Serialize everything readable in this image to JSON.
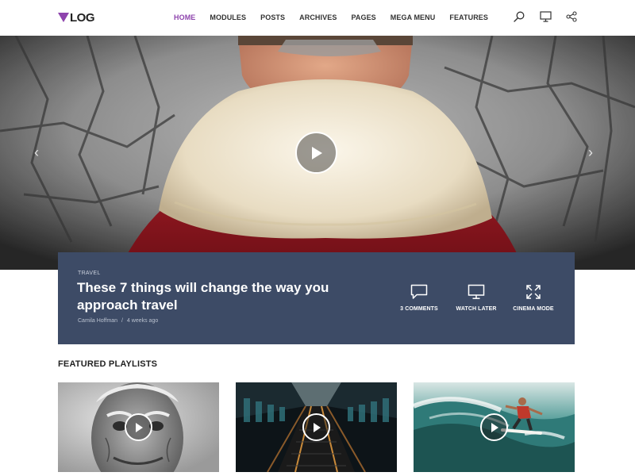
{
  "logo": {
    "text": "LOG",
    "accent": "#8e44ad"
  },
  "nav": {
    "items": [
      {
        "label": "HOME",
        "active": true
      },
      {
        "label": "MODULES",
        "active": false
      },
      {
        "label": "POSTS",
        "active": false
      },
      {
        "label": "ARCHIVES",
        "active": false
      },
      {
        "label": "PAGES",
        "active": false
      },
      {
        "label": "MEGA MENU",
        "active": false
      },
      {
        "label": "FEATURES",
        "active": false
      }
    ]
  },
  "header_icons": [
    "search-icon",
    "monitor-icon",
    "share-icon"
  ],
  "hero": {
    "prev_arrow": "‹",
    "next_arrow": "›",
    "play_icon": "play-icon"
  },
  "featured_post": {
    "category": "TRAVEL",
    "title": "These 7 things will change the way you approach travel",
    "author": "Camila Hoffman",
    "separator": "/",
    "time": "4 weeks ago",
    "actions": [
      {
        "icon": "comment-icon",
        "label": "3 COMMENTS"
      },
      {
        "icon": "monitor-icon",
        "label": "WATCH LATER"
      },
      {
        "icon": "expand-icon",
        "label": "CINEMA MODE"
      }
    ],
    "background": "#3d4b66"
  },
  "featured_playlists": {
    "title": "FEATURED PLAYLISTS",
    "items": [
      {
        "image": "old-man-portrait"
      },
      {
        "image": "subway-escalator"
      },
      {
        "image": "surfer-wave"
      }
    ]
  }
}
